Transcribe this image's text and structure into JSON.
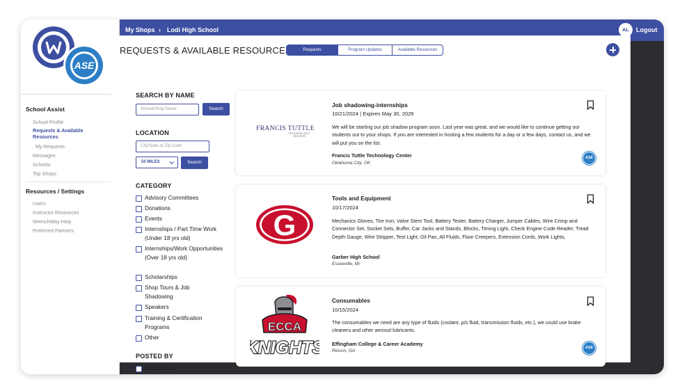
{
  "header": {
    "crumb_root": "My Shops",
    "crumb_sep": "›",
    "crumb_current": "Lodi High School",
    "avatar_initials": "AL",
    "logout_label": "Logout"
  },
  "sidebar": {
    "logo_text": "ASE",
    "section_1": "School Assist",
    "items_1": [
      "School Profile",
      "Requests & Available Resources",
      "My Requests",
      "Messages",
      "Schools",
      "Top Shops"
    ],
    "section_2": "Resources / Settings",
    "items_2": [
      "Users",
      "Instructor Resources",
      "WrenchWay Help",
      "Preferred Partners"
    ]
  },
  "main": {
    "title": "REQUESTS & AVAILABLE RESOURCES",
    "tabs": [
      "Requests",
      "Program Updates",
      "Available Resources"
    ],
    "selected_tab": "Requests"
  },
  "filters": {
    "search_heading": "SEARCH BY NAME",
    "search_placeholder": "School/Shop Name",
    "search_button": "Search",
    "location_heading": "LOCATION",
    "location_placeholder": "City/State or Zip Code",
    "radius_value": "50 MILES",
    "location_button": "Search",
    "category_heading": "CATEGORY",
    "categories": [
      "Advisory Committees",
      "Donations",
      "Events",
      "Internships / Part Time Work (Under 18 yrs old)",
      "Internships/Work Opportunities (Over 18 yrs old)",
      "Scholarships",
      "Shop Tours & Job Shadowing",
      "Speakers",
      "Training & Certification Programs",
      "Other"
    ],
    "posted_heading": "POSTED BY",
    "posted_options": [
      "High School"
    ]
  },
  "cards": [
    {
      "logo_text_main": "FRANCIS TUTTLE",
      "logo_text_sub": "TECHNOLOGY CENTER",
      "title": "Job shadowing-internships",
      "date": "10/21/2024 | Expires May 30, 2026",
      "body": "We will be starting our job shadow program soon. Last year was great, and we would like to continue getting our students out to your shops. If you are interested in hosting a few students for a day or a few days, contact us, and we will put you on the list.",
      "org": "Francis Tuttle Technology Center",
      "location": "Oklahoma City, OK",
      "badge": "ASE"
    },
    {
      "logo_text_main": "G",
      "title": "Tools and Equipment",
      "date": "10/17/2024",
      "body": "Mechanics Gloves, Tire Iron, Valve Stem Tool, Battery Tester, Battery Charger, Jumper Cables, Wire Crimp and Connector Set, Socket Sets, Buffer, Car Jacks and Stands, Blocks, Timing Light, Check Engine Code Reader, Tread Depth Gauge, Wire Stripper, Test Light, Oil Pan, All Fluids, Floor Creepers, Extension Cords, Work Lights,",
      "org": "Garber High School",
      "location": "Essexville, MI"
    },
    {
      "logo_text_main": "ECCA",
      "logo_text_sub": "KNIGHTS",
      "title": "Consumables",
      "date": "10/15/2024",
      "body": "The consumables we need are any type of fluids (coolant, p/s fluid, transmission fluids, etc.), we could use brake cleaners and other aerosol lubricants.",
      "org": "Effingham College & Career Academy",
      "location": "Rincon, GA",
      "badge": "ASE"
    }
  ],
  "colors": {
    "brand": "#3d4fa1",
    "ase_blue": "#2c7fc6",
    "garber_red": "#c8102e"
  }
}
